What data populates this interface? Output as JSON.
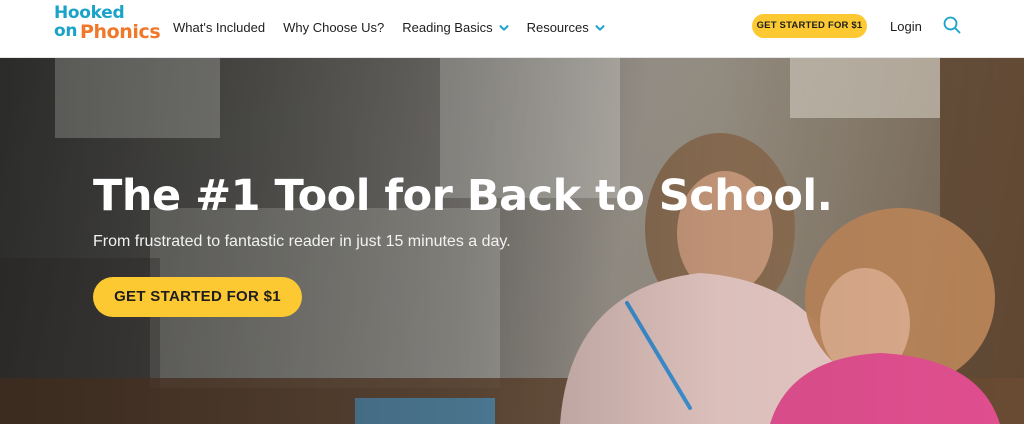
{
  "logo": {
    "line1": "Hooked",
    "line2a": "on",
    "line2b": "Phonics"
  },
  "nav": {
    "items": [
      {
        "label": "What's Included",
        "dropdown": false
      },
      {
        "label": "Why Choose Us?",
        "dropdown": false
      },
      {
        "label": "Reading Basics",
        "dropdown": true
      },
      {
        "label": "Resources",
        "dropdown": true
      }
    ],
    "cta_label": "GET STARTED FOR $1",
    "login_label": "Login",
    "search_icon": "search-icon"
  },
  "hero": {
    "title": "The #1 Tool for Back to School.",
    "subtitle": "From frustrated to fantastic reader in just 15 minutes a day.",
    "cta_label": "GET STARTED FOR $1"
  },
  "colors": {
    "brand_blue": "#1aa3c9",
    "brand_orange": "#f0782a",
    "cta_yellow": "#fcc932",
    "chevron_blue": "#1aa3c9"
  }
}
